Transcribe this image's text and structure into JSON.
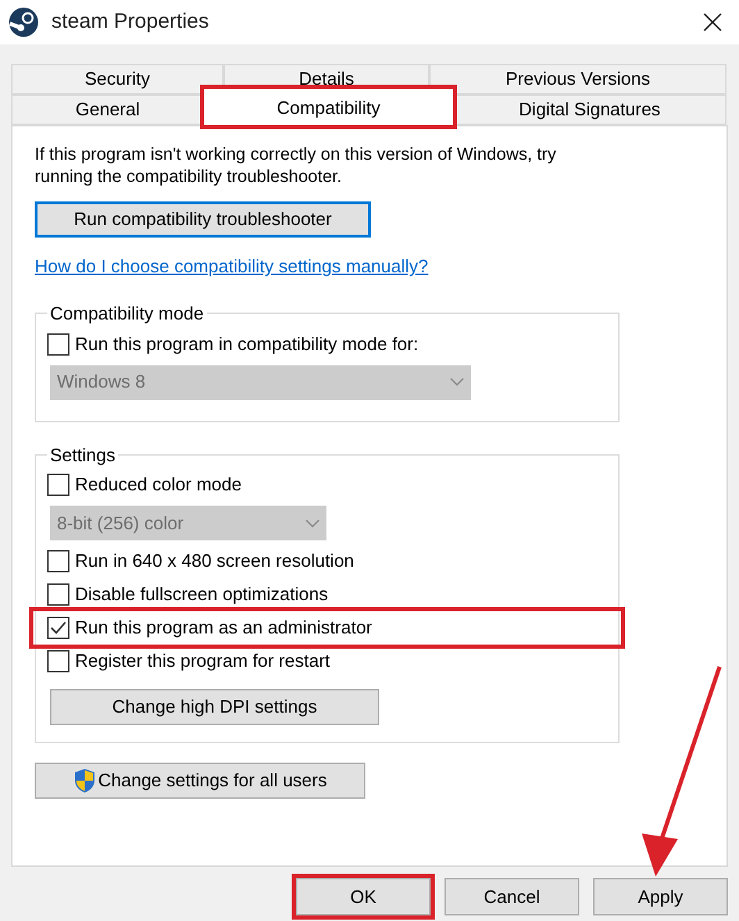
{
  "window": {
    "title": "steam Properties"
  },
  "tab_rows": [
    [
      {
        "label": "Security",
        "selected": false,
        "highlighted": false
      },
      {
        "label": "Details",
        "selected": false,
        "highlighted": false
      },
      {
        "label": "Previous Versions",
        "selected": false,
        "highlighted": false
      }
    ],
    [
      {
        "label": "General",
        "selected": false,
        "highlighted": false
      },
      {
        "label": "Compatibility",
        "selected": true,
        "highlighted": true
      },
      {
        "label": "Digital Signatures",
        "selected": false,
        "highlighted": false
      }
    ]
  ],
  "intro": "If this program isn't working correctly on this version of Windows, try running the compatibility troubleshooter.",
  "troubleshooter_button": "Run compatibility troubleshooter",
  "help_link": "How do I choose compatibility settings manually?",
  "groups": [
    {
      "title": "Compatibility mode",
      "items": [
        {
          "kind": "checkbox",
          "label": "Run this program in compatibility mode for:",
          "checked": false,
          "highlighted": false
        },
        {
          "kind": "dropdown",
          "value": "Windows 8",
          "disabled": true,
          "wide": true
        }
      ]
    },
    {
      "title": "Settings",
      "items": [
        {
          "kind": "checkbox",
          "label": "Reduced color mode",
          "checked": false,
          "highlighted": false
        },
        {
          "kind": "dropdown",
          "value": "8-bit (256) color",
          "disabled": true,
          "wide": false
        },
        {
          "kind": "checkbox",
          "label": "Run in 640 x 480 screen resolution",
          "checked": false,
          "highlighted": false
        },
        {
          "kind": "checkbox",
          "label": "Disable fullscreen optimizations",
          "checked": false,
          "highlighted": false
        },
        {
          "kind": "checkbox",
          "label": "Run this program as an administrator",
          "checked": true,
          "highlighted": true
        },
        {
          "kind": "checkbox",
          "label": "Register this program for restart",
          "checked": false,
          "highlighted": false
        },
        {
          "kind": "button",
          "label": "Change high DPI settings"
        }
      ]
    }
  ],
  "all_users_button": "Change settings for all users",
  "buttons": [
    {
      "label": "OK",
      "highlighted": true,
      "arrow": false
    },
    {
      "label": "Cancel",
      "highlighted": false,
      "arrow": false
    },
    {
      "label": "Apply",
      "highlighted": false,
      "arrow": true
    }
  ]
}
